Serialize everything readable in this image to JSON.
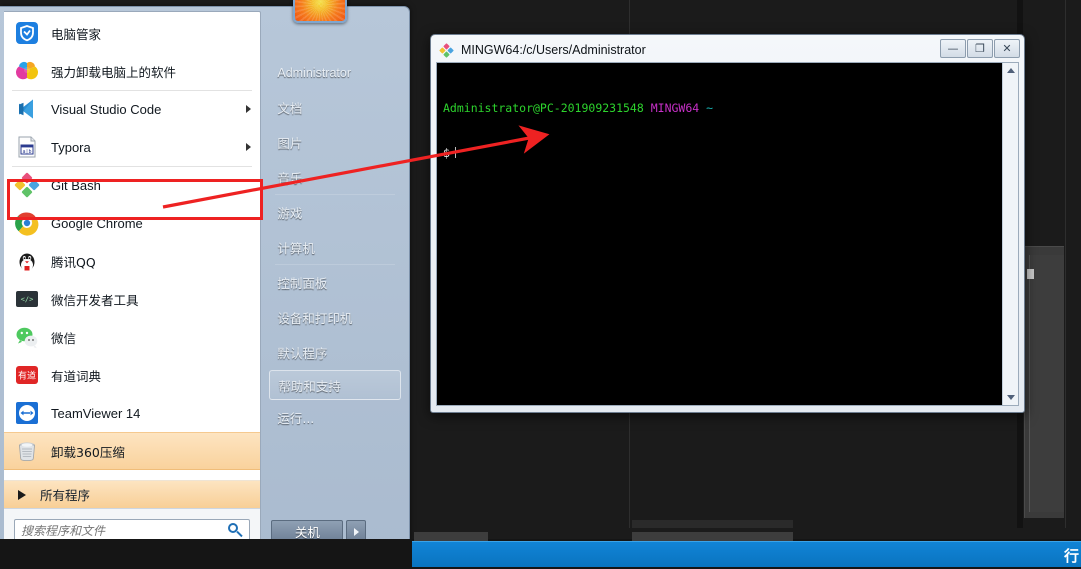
{
  "desktop": {
    "background_color": "#1b1b1b"
  },
  "start_menu": {
    "programs": [
      {
        "label": "电脑管家",
        "icon": "pc-manager-icon",
        "submenu": false,
        "highlighted": false,
        "divider_above": false
      },
      {
        "label": "强力卸载电脑上的软件",
        "icon": "uninstaller-icon",
        "submenu": false,
        "highlighted": false,
        "divider_above": false
      },
      {
        "label": "Visual Studio Code",
        "icon": "vscode-icon",
        "submenu": true,
        "highlighted": false,
        "divider_above": true
      },
      {
        "label": "Typora",
        "icon": "typora-icon",
        "submenu": true,
        "highlighted": false,
        "divider_above": false
      },
      {
        "label": "Git Bash",
        "icon": "git-bash-icon",
        "submenu": false,
        "highlighted": false,
        "divider_above": true
      },
      {
        "label": "Google Chrome",
        "icon": "chrome-icon",
        "submenu": false,
        "highlighted": false,
        "divider_above": false
      },
      {
        "label": "腾讯QQ",
        "icon": "qq-icon",
        "submenu": false,
        "highlighted": false,
        "divider_above": false
      },
      {
        "label": "微信开发者工具",
        "icon": "wechat-devtools-icon",
        "submenu": false,
        "highlighted": false,
        "divider_above": false
      },
      {
        "label": "微信",
        "icon": "wechat-icon",
        "submenu": false,
        "highlighted": false,
        "divider_above": false
      },
      {
        "label": "有道词典",
        "icon": "youdao-dict-icon",
        "submenu": false,
        "highlighted": false,
        "divider_above": false
      },
      {
        "label": "TeamViewer 14",
        "icon": "teamviewer-icon",
        "submenu": false,
        "highlighted": false,
        "divider_above": false
      },
      {
        "label": "卸载360压缩",
        "icon": "recycle-bin-icon",
        "submenu": false,
        "highlighted": true,
        "divider_above": false
      }
    ],
    "all_programs_label": "所有程序",
    "search": {
      "placeholder": "搜索程序和文件",
      "value": ""
    },
    "places": [
      {
        "label": "Administrator",
        "lang": "en",
        "separator_below": false,
        "framed": false
      },
      {
        "label": "文档",
        "lang": "cn",
        "separator_below": false,
        "framed": false
      },
      {
        "label": "图片",
        "lang": "cn",
        "separator_below": false,
        "framed": false
      },
      {
        "label": "音乐",
        "lang": "cn",
        "separator_below": true,
        "framed": false
      },
      {
        "label": "游戏",
        "lang": "cn",
        "separator_below": false,
        "framed": false
      },
      {
        "label": "计算机",
        "lang": "cn",
        "separator_below": true,
        "framed": false
      },
      {
        "label": "控制面板",
        "lang": "cn",
        "separator_below": false,
        "framed": false
      },
      {
        "label": "设备和打印机",
        "lang": "cn",
        "separator_below": false,
        "framed": false
      },
      {
        "label": "默认程序",
        "lang": "cn",
        "separator_below": false,
        "framed": false
      },
      {
        "label": "帮助和支持",
        "lang": "cn",
        "separator_below": false,
        "framed": true
      },
      {
        "label": "运行...",
        "lang": "cn",
        "separator_below": false,
        "framed": false
      }
    ],
    "shutdown": {
      "label": "关机",
      "menu_arrow": "▶"
    },
    "avatar_name": "user-avatar-flower"
  },
  "terminal": {
    "title": "MINGW64:/c/Users/Administrator",
    "icon": "git-bash-icon",
    "window_controls": {
      "minimize": "—",
      "maximize": "❐",
      "close": "✕"
    },
    "lines": [
      {
        "segments": [
          {
            "text": "Administrator@PC-201909231548",
            "color": "#2dd42d"
          },
          {
            "text": " MINGW64",
            "color": "#c830c8"
          },
          {
            "text": " ~",
            "color": "#18b2b2"
          }
        ]
      },
      {
        "segments": [
          {
            "text": "$",
            "color": "#e8e8e8"
          }
        ]
      }
    ],
    "prompt_user_host": "Administrator@PC-201909231548",
    "prompt_shell": "MINGW64",
    "prompt_path": "~",
    "prompt_symbol": "$",
    "background_color": "#000000",
    "scrollbar": {
      "up": "▲",
      "down": "▼"
    }
  },
  "taskbar": {
    "background_color": "#151515",
    "active_band_color": "#1184d6",
    "edge_text": "行"
  },
  "annotation": {
    "highlight_color": "#ee2222",
    "box_target": "Git Bash",
    "arrow_points_to": "terminal-window"
  }
}
